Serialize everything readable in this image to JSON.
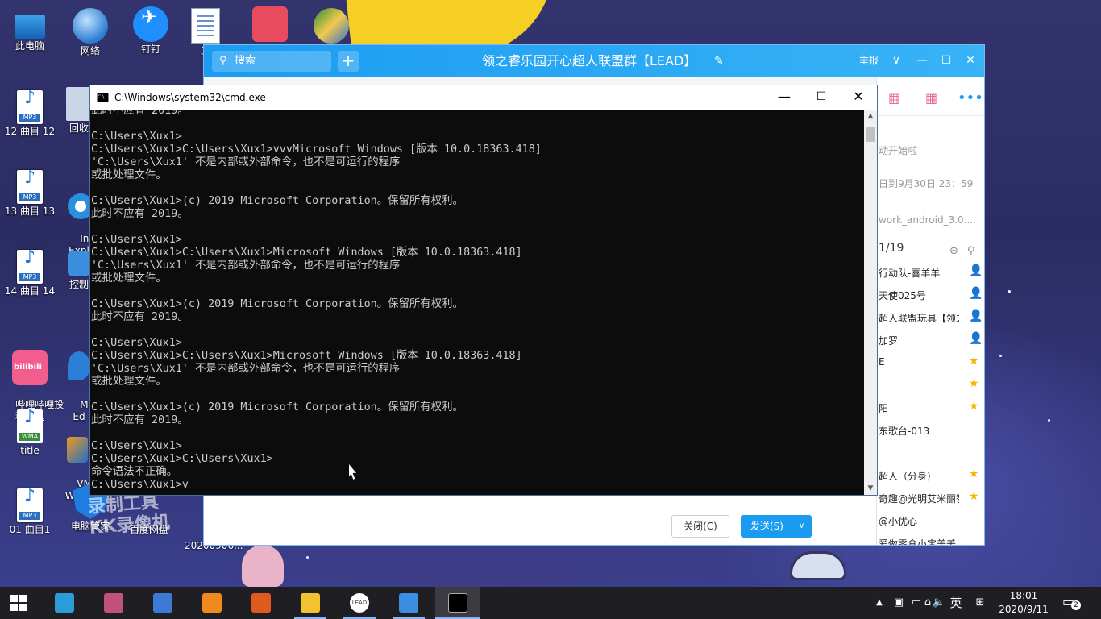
{
  "desktop": {
    "icons": [
      {
        "label": "此电脑",
        "icon": "computer-icon"
      },
      {
        "label": "网络",
        "icon": "network-icon"
      },
      {
        "label": "钉钉",
        "icon": "dingtalk-icon"
      },
      {
        "label": "工",
        "icon": "document-icon"
      },
      {
        "label": "",
        "icon": "game-icon"
      },
      {
        "label": "",
        "icon": "shield-icon"
      },
      {
        "label": "12 曲目 12",
        "icon": "mp3-file-icon",
        "ext": "MP3"
      },
      {
        "label": "回收",
        "icon": "recycle-bin-icon"
      },
      {
        "label": "13 曲目 13",
        "icon": "mp3-file-icon",
        "ext": "MP3"
      },
      {
        "label": "Inte\nExpl",
        "icon": "ie-icon"
      },
      {
        "label": "14 曲目 14",
        "icon": "mp3-file-icon",
        "ext": "MP3"
      },
      {
        "label": "控制",
        "icon": "control-panel-icon"
      },
      {
        "label": "哔哩哔哩投\n稿工具",
        "icon": "bilibili-icon"
      },
      {
        "label": "Micr\nEd",
        "icon": "edge-icon"
      },
      {
        "label": "title",
        "icon": "wma-file-icon",
        "ext": "WMA"
      },
      {
        "label": "VM\nWork",
        "icon": "vmware-icon"
      },
      {
        "label": "01 曲目1",
        "icon": "mp3-file-icon",
        "ext": "MP3"
      },
      {
        "label": "电脑管家",
        "icon": "pc-manager-icon"
      },
      {
        "label": "百度网盘",
        "icon": "baidu-pan-icon"
      },
      {
        "label": "20200906...",
        "icon": "file-icon"
      }
    ],
    "watermark": "录制工具\nKK录像机"
  },
  "qq": {
    "search_placeholder": "搜索",
    "title": "领之睿乐园开心超人联盟群【LEAD】",
    "report": "举报",
    "right_texts": [
      "动开始啦",
      "日到9月30日 23：59",
      "work_android_3.0....",
      "1/19"
    ],
    "members": [
      {
        "name": "行动队-喜羊羊",
        "badge": "person-icon"
      },
      {
        "name": "天使025号",
        "badge": "person-icon"
      },
      {
        "name": "超人联盟玩具【领之",
        "badge": "person-icon"
      },
      {
        "name": "加罗",
        "badge": "person-icon"
      },
      {
        "name": "E",
        "badge": "star-icon"
      },
      {
        "name": "",
        "badge": "star-icon"
      },
      {
        "name": "阳",
        "badge": "star-icon"
      },
      {
        "name": "东歌台-013",
        "badge": ""
      },
      {
        "name": "",
        "badge": ""
      },
      {
        "name": "超人（分身）",
        "badge": "star-icon"
      },
      {
        "name": "奇趣@光明艾米丽智",
        "badge": "star-icon"
      },
      {
        "name": "@小优心",
        "badge": ""
      },
      {
        "name": "爱做零食小宝美美",
        "badge": ""
      }
    ],
    "close_label": "关闭(C)",
    "send_label": "发送(S)"
  },
  "cmd": {
    "title": "C:\\Windows\\system32\\cmd.exe",
    "lines": [
      "此时不应有 2019。",
      "",
      "C:\\Users\\Xux1>",
      "C:\\Users\\Xux1>C:\\Users\\Xux1>vvvMicrosoft Windows [版本 10.0.18363.418]",
      "'C:\\Users\\Xux1' 不是内部或外部命令，也不是可运行的程序",
      "或批处理文件。",
      "",
      "C:\\Users\\Xux1>(c) 2019 Microsoft Corporation。保留所有权利。",
      "此时不应有 2019。",
      "",
      "C:\\Users\\Xux1>",
      "C:\\Users\\Xux1>C:\\Users\\Xux1>Microsoft Windows [版本 10.0.18363.418]",
      "'C:\\Users\\Xux1' 不是内部或外部命令，也不是可运行的程序",
      "或批处理文件。",
      "",
      "C:\\Users\\Xux1>(c) 2019 Microsoft Corporation。保留所有权利。",
      "此时不应有 2019。",
      "",
      "C:\\Users\\Xux1>",
      "C:\\Users\\Xux1>C:\\Users\\Xux1>Microsoft Windows [版本 10.0.18363.418]",
      "'C:\\Users\\Xux1' 不是内部或外部命令，也不是可运行的程序",
      "或批处理文件。",
      "",
      "C:\\Users\\Xux1>(c) 2019 Microsoft Corporation。保留所有权利。",
      "此时不应有 2019。",
      "",
      "C:\\Users\\Xux1>",
      "C:\\Users\\Xux1>C:\\Users\\Xux1>",
      "命令语法不正确。",
      "C:\\Users\\Xux1>v"
    ]
  },
  "taskbar": {
    "apps": [
      {
        "name": "start-button",
        "icon": "windows-icon"
      },
      {
        "name": "taskbar-edge",
        "icon": "edge-icon",
        "color": "#2b9cd8"
      },
      {
        "name": "taskbar-app-1",
        "icon": "app-icon",
        "color": "#c0537a"
      },
      {
        "name": "taskbar-app-2",
        "icon": "app-icon",
        "color": "#3d7ad6"
      },
      {
        "name": "taskbar-app-3",
        "icon": "app-icon",
        "color": "#f08a1c"
      },
      {
        "name": "taskbar-app-4",
        "icon": "app-icon",
        "color": "#e05a1e"
      },
      {
        "name": "taskbar-explorer",
        "icon": "folder-icon",
        "color": "#f2c230"
      },
      {
        "name": "taskbar-lead",
        "icon": "lead-icon",
        "color": "#ffffff"
      },
      {
        "name": "taskbar-photos",
        "icon": "photo-icon",
        "color": "#3a8fe0"
      },
      {
        "name": "taskbar-cmd",
        "icon": "cmd-icon",
        "color": "#000000"
      }
    ],
    "lead_text": "LEAD",
    "ime": "英",
    "time": "18:01",
    "date": "2020/9/11",
    "notifications": "2"
  }
}
